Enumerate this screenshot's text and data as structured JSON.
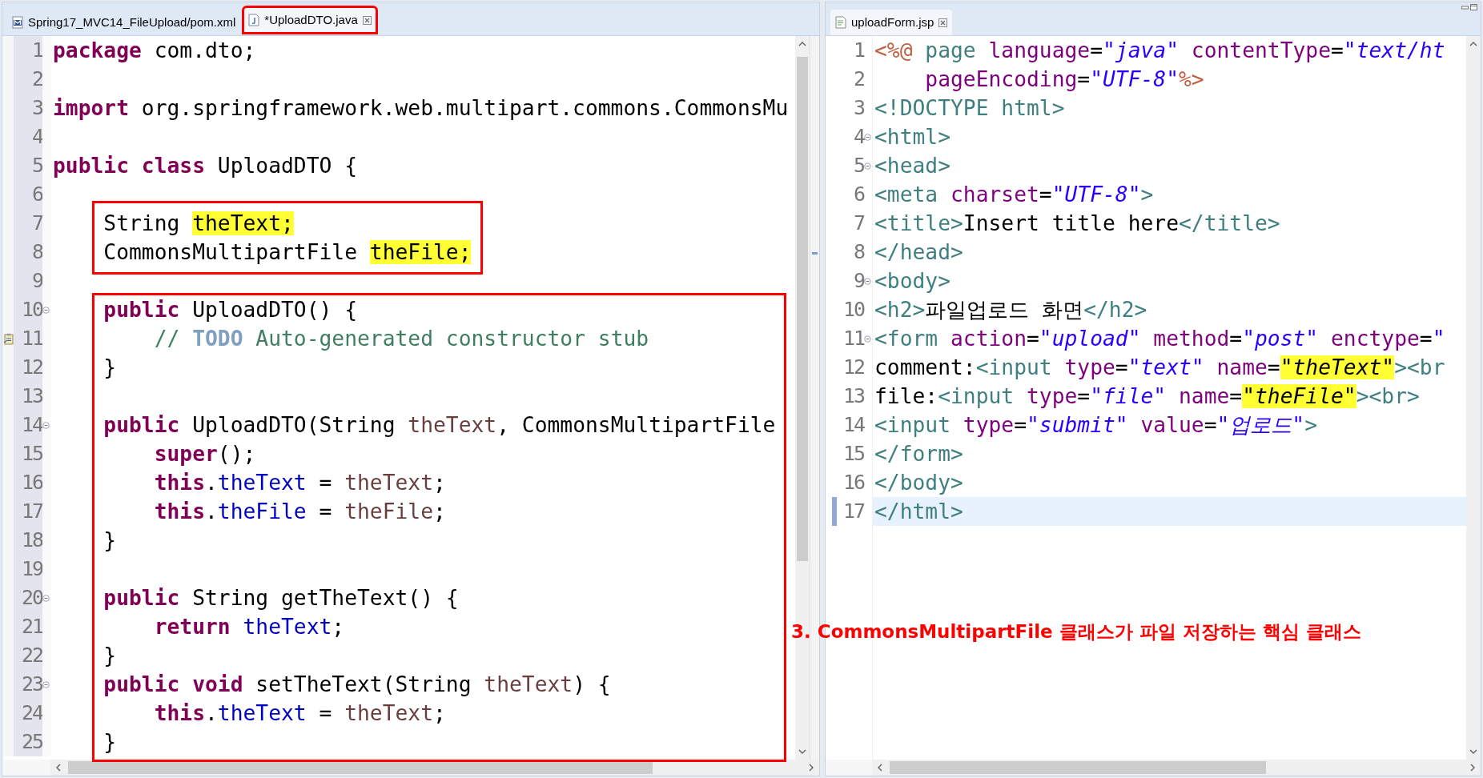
{
  "left_editor": {
    "tabs": [
      {
        "label": "Spring17_MVC14_FileUpload/pom.xml",
        "selected": false,
        "closable": false,
        "marked": false
      },
      {
        "label": "*UploadDTO.java",
        "selected": true,
        "closable": true,
        "marked": true
      }
    ],
    "lines": [
      {
        "number": "1",
        "fold": false,
        "task": false,
        "segments": [
          {
            "text": "package",
            "kind": "kw"
          },
          {
            "text": " com.dto;",
            "kind": "plain"
          }
        ]
      },
      {
        "number": "2",
        "fold": false,
        "task": false
      },
      {
        "number": "3",
        "fold": false,
        "task": false,
        "segments": [
          {
            "text": "import",
            "kind": "kw"
          },
          {
            "text": " org.springframework.web.multipart.commons.CommonsMu",
            "kind": "plain"
          }
        ]
      },
      {
        "number": "4",
        "fold": false,
        "task": false
      },
      {
        "number": "5",
        "fold": false,
        "task": false,
        "segments": [
          {
            "text": "public class",
            "kind": "kw"
          },
          {
            "text": " UploadDTO {",
            "kind": "plain"
          }
        ]
      },
      {
        "number": "6",
        "fold": false,
        "task": false
      },
      {
        "number": "7",
        "fold": false,
        "task": false,
        "segments": [
          {
            "text": "    String ",
            "kind": "plain"
          },
          {
            "text": "theText;",
            "kind": "hl"
          }
        ]
      },
      {
        "number": "8",
        "fold": false,
        "task": false,
        "segments": [
          {
            "text": "    CommonsMultipartFile ",
            "kind": "plain"
          },
          {
            "text": "theFile;",
            "kind": "hl"
          }
        ]
      },
      {
        "number": "9",
        "fold": false,
        "task": false
      },
      {
        "number": "10",
        "fold": true,
        "task": false,
        "segments": [
          {
            "text": "    public",
            "kind": "kw"
          },
          {
            "text": " UploadDTO() {",
            "kind": "plain"
          }
        ]
      },
      {
        "number": "11",
        "fold": false,
        "task": true,
        "segments": [
          {
            "text": "        // ",
            "kind": "comment"
          },
          {
            "text": "TODO",
            "kind": "todo"
          },
          {
            "text": " Auto-generated constructor stub",
            "kind": "comment"
          }
        ]
      },
      {
        "number": "12",
        "fold": false,
        "task": false,
        "segments": [
          {
            "text": "    }",
            "kind": "plain"
          }
        ]
      },
      {
        "number": "13",
        "fold": false,
        "task": false
      },
      {
        "number": "14",
        "fold": true,
        "task": false,
        "segments": [
          {
            "text": "    public",
            "kind": "kw"
          },
          {
            "text": " UploadDTO(String ",
            "kind": "plain"
          },
          {
            "text": "theText",
            "kind": "param"
          },
          {
            "text": ", CommonsMultipartFile",
            "kind": "plain"
          }
        ]
      },
      {
        "number": "15",
        "fold": false,
        "task": false,
        "segments": [
          {
            "text": "        super",
            "kind": "kw"
          },
          {
            "text": "();",
            "kind": "plain"
          }
        ]
      },
      {
        "number": "16",
        "fold": false,
        "task": false,
        "segments": [
          {
            "text": "        this",
            "kind": "kw"
          },
          {
            "text": ".",
            "kind": "plain"
          },
          {
            "text": "theText",
            "kind": "field"
          },
          {
            "text": " = ",
            "kind": "plain"
          },
          {
            "text": "theText",
            "kind": "param"
          },
          {
            "text": ";",
            "kind": "plain"
          }
        ]
      },
      {
        "number": "17",
        "fold": false,
        "task": false,
        "segments": [
          {
            "text": "        this",
            "kind": "kw"
          },
          {
            "text": ".",
            "kind": "plain"
          },
          {
            "text": "theFile",
            "kind": "field"
          },
          {
            "text": " = ",
            "kind": "plain"
          },
          {
            "text": "theFile",
            "kind": "param"
          },
          {
            "text": ";",
            "kind": "plain"
          }
        ]
      },
      {
        "number": "18",
        "fold": false,
        "task": false,
        "segments": [
          {
            "text": "    }",
            "kind": "plain"
          }
        ]
      },
      {
        "number": "19",
        "fold": false,
        "task": false
      },
      {
        "number": "20",
        "fold": true,
        "task": false,
        "segments": [
          {
            "text": "    public",
            "kind": "kw"
          },
          {
            "text": " String getTheText() {",
            "kind": "plain"
          }
        ]
      },
      {
        "number": "21",
        "fold": false,
        "task": false,
        "segments": [
          {
            "text": "        return",
            "kind": "kw"
          },
          {
            "text": " theText",
            "kind": "field"
          },
          {
            "text": ";",
            "kind": "plain"
          }
        ]
      },
      {
        "number": "22",
        "fold": false,
        "task": false,
        "segments": [
          {
            "text": "    }",
            "kind": "plain"
          }
        ]
      },
      {
        "number": "23",
        "fold": true,
        "task": false,
        "segments": [
          {
            "text": "    public void",
            "kind": "kw"
          },
          {
            "text": " setTheText(String ",
            "kind": "plain"
          },
          {
            "text": "theText",
            "kind": "param"
          },
          {
            "text": ") {",
            "kind": "plain"
          }
        ]
      },
      {
        "number": "24",
        "fold": false,
        "task": false,
        "segments": [
          {
            "text": "        this",
            "kind": "kw"
          },
          {
            "text": ".",
            "kind": "plain"
          },
          {
            "text": "theText",
            "kind": "field"
          },
          {
            "text": " = ",
            "kind": "plain"
          },
          {
            "text": "theText",
            "kind": "param"
          },
          {
            "text": ";",
            "kind": "plain"
          }
        ]
      },
      {
        "number": "25",
        "fold": false,
        "task": false,
        "segments": [
          {
            "text": "    }",
            "kind": "plain"
          }
        ]
      }
    ]
  },
  "right_editor": {
    "tabs": [
      {
        "label": "uploadForm.jsp",
        "selected": true,
        "closable": true,
        "marked": false
      }
    ],
    "lines": [
      {
        "number": "1",
        "fold": false,
        "current": false,
        "segments": [
          {
            "text": "<%@",
            "kind": "jsp"
          },
          {
            "text": " page",
            "kind": "tag"
          },
          {
            "text": " language",
            "kind": "attr"
          },
          {
            "text": "=",
            "kind": "plain"
          },
          {
            "text": "\"java\"",
            "kind": "str"
          },
          {
            "text": " contentType",
            "kind": "attr"
          },
          {
            "text": "=",
            "kind": "plain"
          },
          {
            "text": "\"text/ht",
            "kind": "str"
          }
        ]
      },
      {
        "number": "2",
        "fold": false,
        "current": false,
        "segments": [
          {
            "text": "    pageEncoding",
            "kind": "attr"
          },
          {
            "text": "=",
            "kind": "plain"
          },
          {
            "text": "\"UTF-8\"",
            "kind": "str"
          },
          {
            "text": "%>",
            "kind": "jsp"
          }
        ]
      },
      {
        "number": "3",
        "fold": false,
        "current": false,
        "segments": [
          {
            "text": "<!DOCTYPE html>",
            "kind": "tag"
          }
        ]
      },
      {
        "number": "4",
        "fold": true,
        "current": false,
        "segments": [
          {
            "text": "<html>",
            "kind": "tag"
          }
        ]
      },
      {
        "number": "5",
        "fold": true,
        "current": false,
        "segments": [
          {
            "text": "<head>",
            "kind": "tag"
          }
        ]
      },
      {
        "number": "6",
        "fold": false,
        "current": false,
        "segments": [
          {
            "text": "<meta",
            "kind": "tag"
          },
          {
            "text": " charset",
            "kind": "attr"
          },
          {
            "text": "=",
            "kind": "plain"
          },
          {
            "text": "\"UTF-8\"",
            "kind": "str"
          },
          {
            "text": ">",
            "kind": "tag"
          }
        ]
      },
      {
        "number": "7",
        "fold": false,
        "current": false,
        "segments": [
          {
            "text": "<title>",
            "kind": "tag"
          },
          {
            "text": "Insert title here",
            "kind": "plain"
          },
          {
            "text": "</title>",
            "kind": "tag"
          }
        ]
      },
      {
        "number": "8",
        "fold": false,
        "current": false,
        "segments": [
          {
            "text": "</head>",
            "kind": "tag"
          }
        ]
      },
      {
        "number": "9",
        "fold": true,
        "current": false,
        "segments": [
          {
            "text": "<body>",
            "kind": "tag"
          }
        ]
      },
      {
        "number": "10",
        "fold": false,
        "current": false,
        "segments": [
          {
            "text": "<h2>",
            "kind": "tag"
          },
          {
            "text": "파일업로드 화면",
            "kind": "plain"
          },
          {
            "text": "</h2>",
            "kind": "tag"
          }
        ]
      },
      {
        "number": "11",
        "fold": true,
        "current": false,
        "segments": [
          {
            "text": "<form",
            "kind": "tag"
          },
          {
            "text": " action",
            "kind": "attr"
          },
          {
            "text": "=",
            "kind": "plain"
          },
          {
            "text": "\"upload\"",
            "kind": "str"
          },
          {
            "text": " method",
            "kind": "attr"
          },
          {
            "text": "=",
            "kind": "plain"
          },
          {
            "text": "\"post\"",
            "kind": "str"
          },
          {
            "text": " enctype",
            "kind": "attr"
          },
          {
            "text": "=",
            "kind": "plain"
          },
          {
            "text": "\"",
            "kind": "str"
          }
        ]
      },
      {
        "number": "12",
        "fold": false,
        "current": false,
        "segments": [
          {
            "text": "comment:",
            "kind": "plain"
          },
          {
            "text": "<input",
            "kind": "tag"
          },
          {
            "text": " type",
            "kind": "attr"
          },
          {
            "text": "=",
            "kind": "plain"
          },
          {
            "text": "\"text\"",
            "kind": "str"
          },
          {
            "text": " name",
            "kind": "attr"
          },
          {
            "text": "=",
            "kind": "plain"
          },
          {
            "text": "\"theText\"",
            "kind": "hlstr"
          },
          {
            "text": "><br",
            "kind": "tag"
          }
        ]
      },
      {
        "number": "13",
        "fold": false,
        "current": false,
        "segments": [
          {
            "text": "file:",
            "kind": "plain"
          },
          {
            "text": "<input",
            "kind": "tag"
          },
          {
            "text": " type",
            "kind": "attr"
          },
          {
            "text": "=",
            "kind": "plain"
          },
          {
            "text": "\"file\"",
            "kind": "str"
          },
          {
            "text": " name",
            "kind": "attr"
          },
          {
            "text": "=",
            "kind": "plain"
          },
          {
            "text": "\"theFile\"",
            "kind": "hlstr"
          },
          {
            "text": "><br>",
            "kind": "tag"
          }
        ]
      },
      {
        "number": "14",
        "fold": false,
        "current": false,
        "segments": [
          {
            "text": "<input",
            "kind": "tag"
          },
          {
            "text": " type",
            "kind": "attr"
          },
          {
            "text": "=",
            "kind": "plain"
          },
          {
            "text": "\"submit\"",
            "kind": "str"
          },
          {
            "text": " value",
            "kind": "attr"
          },
          {
            "text": "=",
            "kind": "plain"
          },
          {
            "text": "\"업로드\"",
            "kind": "str"
          },
          {
            "text": ">",
            "kind": "tag"
          }
        ]
      },
      {
        "number": "15",
        "fold": false,
        "current": false,
        "segments": [
          {
            "text": "</form>",
            "kind": "tag"
          }
        ]
      },
      {
        "number": "16",
        "fold": false,
        "current": false,
        "segments": [
          {
            "text": "</body>",
            "kind": "tag"
          }
        ]
      },
      {
        "number": "17",
        "fold": false,
        "current": true,
        "segments": [
          {
            "text": "</html>",
            "kind": "tag"
          }
        ]
      }
    ]
  },
  "annotation": {
    "note": "3. CommonsMultipartFile 클래스가 파일 저장하는 핵심 클래스"
  }
}
